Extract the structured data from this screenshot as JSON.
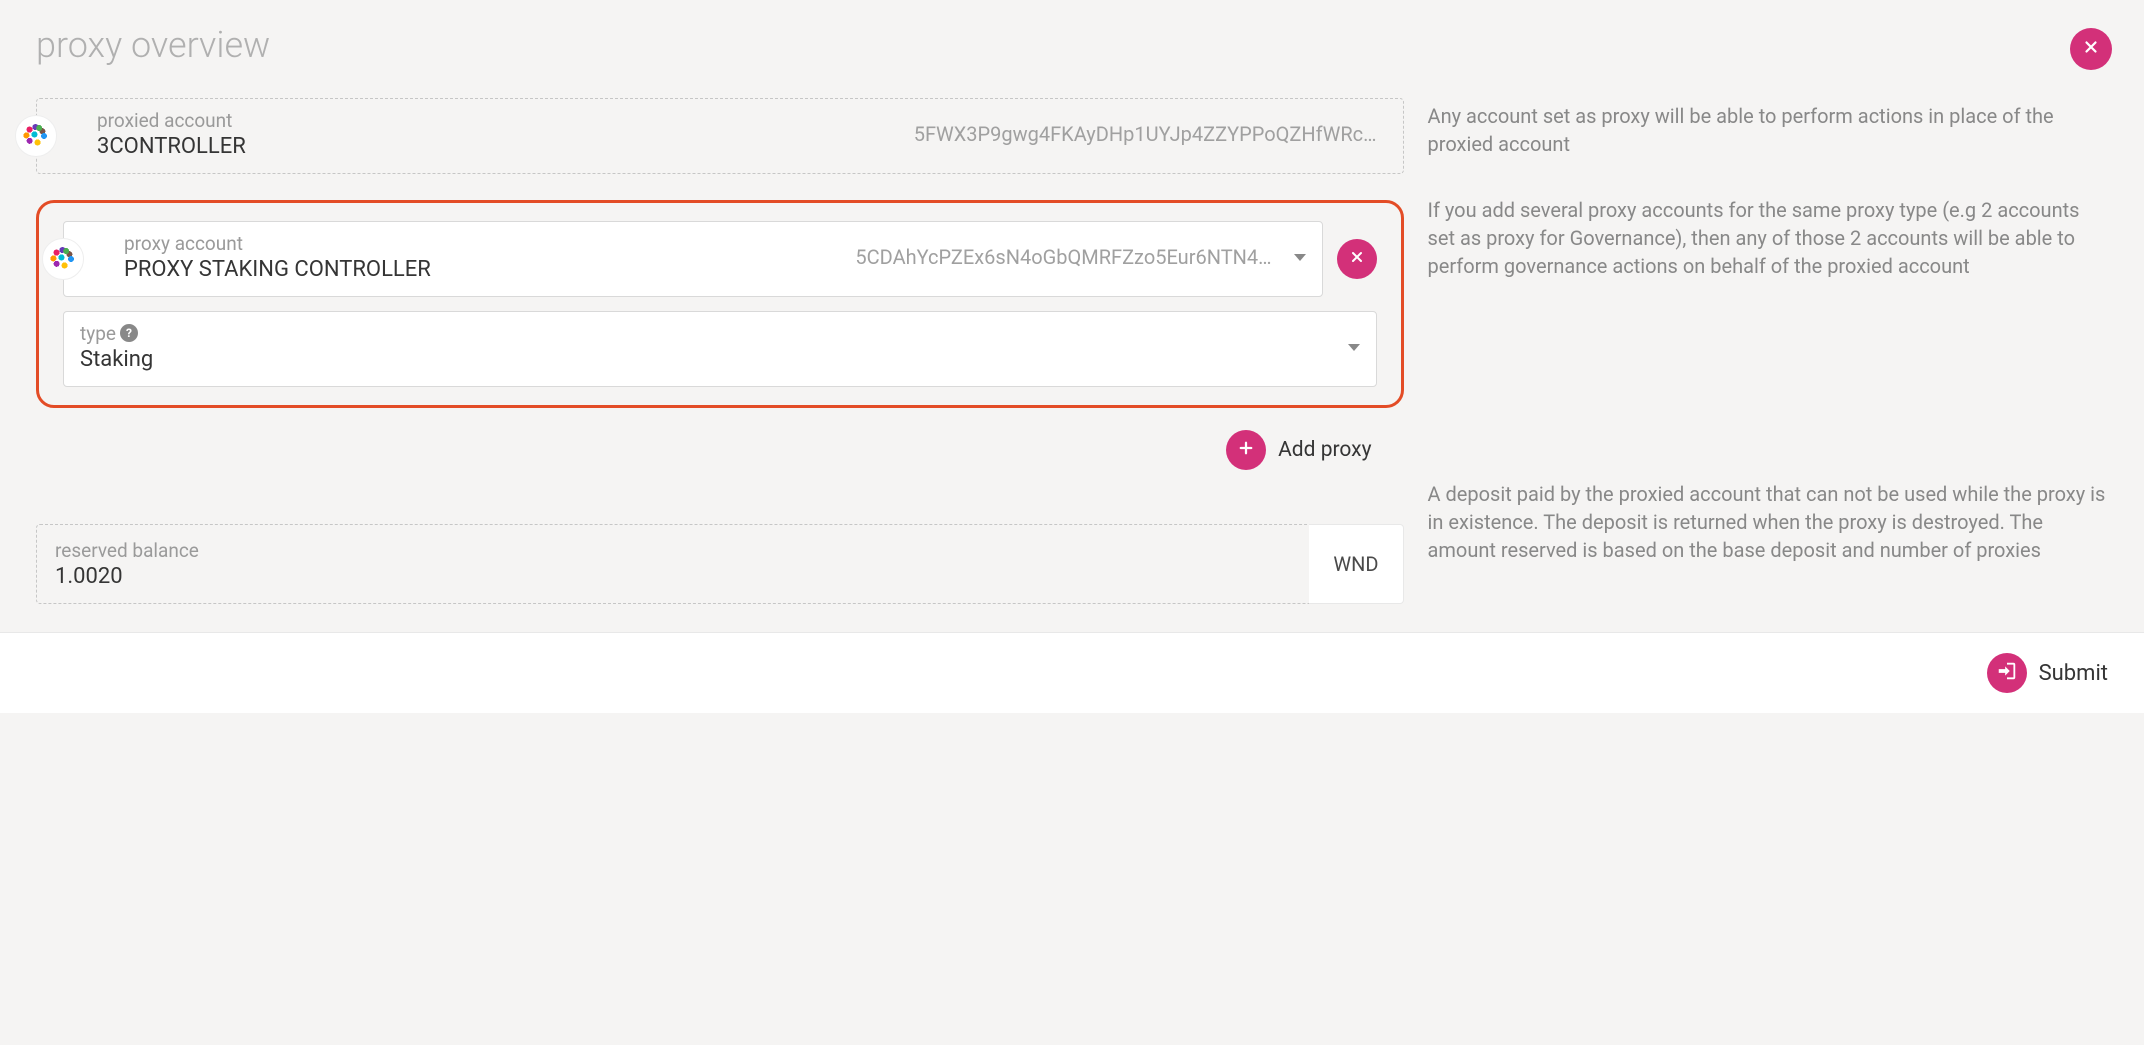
{
  "page_title": "proxy overview",
  "proxied": {
    "label": "proxied account",
    "name": "3CONTROLLER",
    "address": "5FWX3P9gwg4FKAyDHp1UYJp4ZZYPPoQZHfWRc…"
  },
  "help": {
    "line1": "Any account set as proxy will be able to perform actions in place of the proxied account",
    "line2": "If you add several proxy accounts for the same proxy type (e.g 2 accounts set as proxy for Governance), then any of those 2 accounts will be able to perform governance actions on behalf of the proxied account",
    "line3": "A deposit paid by the proxied account that can not be used while the proxy is in existence. The deposit is returned when the proxy is destroyed. The amount reserved is based on the base deposit and number of proxies"
  },
  "proxy": {
    "account_label": "proxy account",
    "account_name": "PROXY STAKING CONTROLLER",
    "account_address": "5CDAhYcPZEx6sN4oGbQMRFZzo5Eur6NTN4…",
    "type_label": "type",
    "type_value": "Staking"
  },
  "add_proxy_label": "Add proxy",
  "reserved": {
    "label": "reserved balance",
    "value": "1.0020",
    "unit": "WND"
  },
  "submit_label": "Submit"
}
